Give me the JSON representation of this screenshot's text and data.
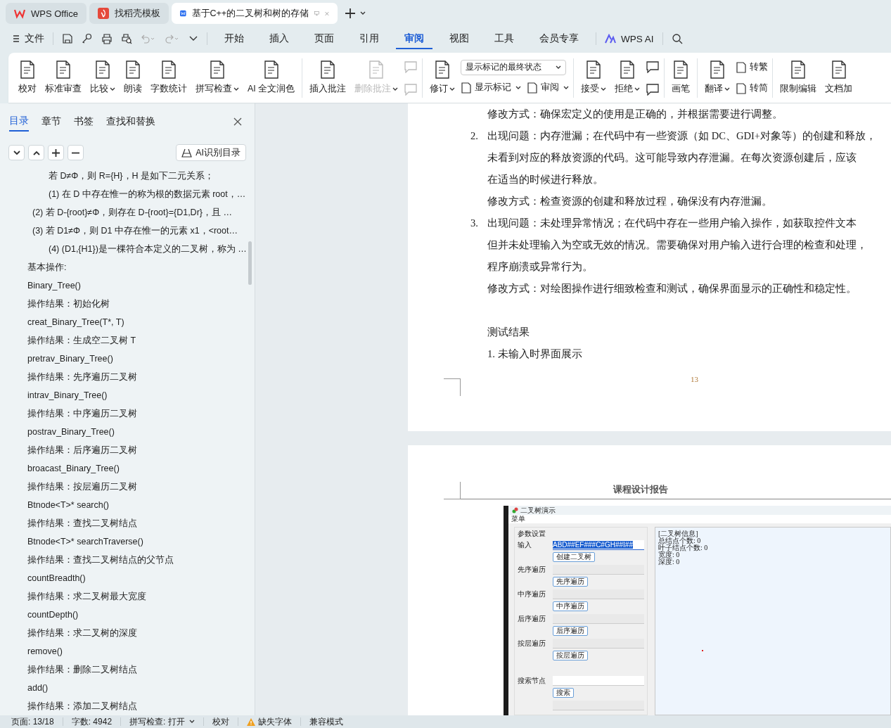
{
  "title_tabs": [
    {
      "label": "WPS Office",
      "selected": false
    },
    {
      "label": "找稻壳模板",
      "selected": false
    },
    {
      "label": "基于C++的二叉树和树的存储",
      "selected": true
    }
  ],
  "menu": {
    "file": "文件",
    "tabs": [
      {
        "label": "开始",
        "selected": false
      },
      {
        "label": "插入",
        "selected": false
      },
      {
        "label": "页面",
        "selected": false
      },
      {
        "label": "引用",
        "selected": false
      },
      {
        "label": "审阅",
        "selected": true
      },
      {
        "label": "视图",
        "selected": false
      },
      {
        "label": "工具",
        "selected": false
      },
      {
        "label": "会员专享",
        "selected": false
      }
    ],
    "ai": "WPS AI"
  },
  "ribbon": {
    "groups": [
      {
        "columns": [
          [
            [
              {
                "kind": "large",
                "label": "校对",
                "dropdown": false,
                "disabled": false
              }
            ]
          ],
          [
            [
              {
                "kind": "large",
                "label": "标准审查",
                "dropdown": false,
                "disabled": false
              }
            ]
          ],
          [
            [
              {
                "kind": "large",
                "label": "比较",
                "dropdown": true,
                "disabled": false
              }
            ]
          ],
          [
            [
              {
                "kind": "large",
                "label": "朗读",
                "dropdown": false,
                "disabled": false
              }
            ]
          ],
          [
            [
              {
                "kind": "large",
                "label": "字数统计",
                "dropdown": false,
                "disabled": false
              }
            ]
          ],
          [
            [
              {
                "kind": "large",
                "label": "拼写检查",
                "dropdown": true,
                "disabled": false
              }
            ]
          ],
          [
            [
              {
                "kind": "large",
                "label": "AI 全文润色",
                "dropdown": false,
                "disabled": false
              }
            ]
          ]
        ]
      },
      {
        "columns": [
          [
            [
              {
                "kind": "large",
                "label": "插入批注",
                "dropdown": false,
                "disabled": false
              }
            ]
          ],
          [
            [
              {
                "kind": "large",
                "label": "删除批注",
                "dropdown": true,
                "disabled": true
              }
            ]
          ],
          [
            [
              {
                "kind": "icon",
                "disabled": true
              }
            ],
            [
              {
                "kind": "icon",
                "disabled": true
              }
            ]
          ]
        ]
      },
      {
        "columns": [
          [
            [
              {
                "kind": "large",
                "label": "修订",
                "dropdown": true,
                "disabled": false
              }
            ]
          ],
          [
            [
              {
                "kind": "select",
                "label": "显示标记的最终状态"
              }
            ],
            [
              {
                "kind": "small",
                "label": "显示标记",
                "dropdown": true,
                "disabled": false
              },
              {
                "kind": "small",
                "label": "审阅",
                "dropdown": true,
                "disabled": false
              }
            ]
          ]
        ]
      },
      {
        "columns": [
          [
            [
              {
                "kind": "large",
                "label": "接受",
                "dropdown": true,
                "disabled": false
              }
            ]
          ],
          [
            [
              {
                "kind": "large",
                "label": "拒绝",
                "dropdown": true,
                "disabled": false
              }
            ]
          ],
          [
            [
              {
                "kind": "icon",
                "disabled": false
              }
            ],
            [
              {
                "kind": "icon",
                "disabled": false
              }
            ]
          ]
        ]
      },
      {
        "columns": [
          [
            [
              {
                "kind": "large",
                "label": "画笔",
                "dropdown": false,
                "disabled": false
              }
            ]
          ]
        ]
      },
      {
        "columns": [
          [
            [
              {
                "kind": "large",
                "label": "翻译",
                "dropdown": true,
                "disabled": false
              }
            ]
          ],
          [
            [
              {
                "kind": "small",
                "label": "转繁",
                "dropdown": false,
                "disabled": false
              }
            ],
            [
              {
                "kind": "small",
                "label": "转简",
                "dropdown": false,
                "disabled": false
              }
            ]
          ]
        ]
      },
      {
        "columns": [
          [
            [
              {
                "kind": "large",
                "label": "限制编辑",
                "dropdown": false,
                "disabled": false
              }
            ]
          ],
          [
            [
              {
                "kind": "large",
                "label": "文档加",
                "dropdown": false,
                "disabled": false
              }
            ]
          ]
        ]
      }
    ]
  },
  "sidebar": {
    "tabs": [
      {
        "label": "目录",
        "selected": true
      },
      {
        "label": "章节",
        "selected": false
      },
      {
        "label": "书签",
        "selected": false
      },
      {
        "label": "查找和替换",
        "selected": false
      }
    ],
    "ai_button": "AI识别目录",
    "toc": [
      {
        "children": [
          {
            "children": [
              {
                "text": "若 D≠Φ，则 R={H}，H 是如下二元关系；"
              },
              {
                "text": "(1) 在 D 中存在惟一的称为根的数据元素 root，…"
              }
            ]
          },
          {
            "text": "(2) 若 D-{root}≠Φ，则存在 D-{root}={D1,Dr}，且 …"
          },
          {
            "text": "(3) 若 D1≠Φ，则 D1 中存在惟一的元素 x1，<root…"
          },
          {
            "children": [
              {
                "text": "(4) (D1,{H1})是一棵符合本定义的二叉树，称为 …"
              }
            ]
          }
        ]
      },
      {
        "text": "基本操作:"
      },
      {
        "text": "Binary_Tree()"
      },
      {
        "text": "操作结果：初始化树"
      },
      {
        "text": "creat_Binary_Tree(T*, T)"
      },
      {
        "text": "操作结果：生成空二叉树 T"
      },
      {
        "text": "pretrav_Binary_Tree()"
      },
      {
        "text": "操作结果：先序遍历二叉树"
      },
      {
        "text": "intrav_Binary_Tree()"
      },
      {
        "text": "操作结果：中序遍历二叉树"
      },
      {
        "text": "postrav_Binary_Tree()"
      },
      {
        "text": "操作结果：后序遍历二叉树"
      },
      {
        "text": "broacast_Binary_Tree()"
      },
      {
        "text": "操作结果：按层遍历二叉树"
      },
      {
        "text": "Btnode<T>* search()"
      },
      {
        "text": "操作结果：查找二叉树结点"
      },
      {
        "text": "Btnode<T>* searchTraverse()"
      },
      {
        "text": "操作结果：查找二叉树结点的父节点"
      },
      {
        "text": "countBreadth()"
      },
      {
        "text": "操作结果：求二叉树最大宽度"
      },
      {
        "text": "countDepth()"
      },
      {
        "text": "操作结果：求二叉树的深度"
      },
      {
        "text": "remove()"
      },
      {
        "text": "操作结果：删除二叉树结点"
      },
      {
        "text": "add()"
      },
      {
        "text": "操作结果：添加二叉树结点"
      }
    ]
  },
  "page1": {
    "paragraphs": [
      {
        "kind": "text",
        "lines": [
          "修改方式：确保宏定义的使用是正确的，并根据需要进行调整。"
        ]
      },
      {
        "kind": "numbered",
        "number": "2.",
        "lines": [
          "出现问题：内存泄漏；在代码中有一些资源（如 DC、GDI+对象等）的创建和释放，",
          "未看到对应的释放资源的代码。这可能导致内存泄漏。在每次资源创建后，应该",
          "在适当的时候进行释放。",
          "修改方式：检查资源的创建和释放过程，确保没有内存泄漏。"
        ]
      },
      {
        "kind": "numbered",
        "number": "3.",
        "lines": [
          "出现问题：未处理异常情况；在代码中存在一些用户输入操作，如获取控件文本",
          "但并未处理输入为空或无效的情况。需要确保对用户输入进行合理的检查和处理，",
          "程序崩溃或异常行为。",
          "修改方式：对绘图操作进行细致检查和测试，确保界面显示的正确性和稳定性。"
        ]
      },
      {
        "kind": "heading",
        "lines": [
          "测试结果"
        ]
      },
      {
        "kind": "text",
        "lines": [
          "1. 未输入时界面展示"
        ]
      }
    ],
    "page_number": "13"
  },
  "page2": {
    "header": "课程设计报告",
    "figure": {
      "window_title": "二叉树演示",
      "menu": "菜单",
      "group_title": "参数设置",
      "input": {
        "label": "输入",
        "value": "ABD##EF###C#GH##I##",
        "text_selected": true
      },
      "create_button": "创建二叉树",
      "traversals": [
        {
          "label": "先序遍历",
          "button": "先序遍历"
        },
        {
          "label": "中序遍历",
          "button": "中序遍历"
        },
        {
          "label": "后序遍历",
          "button": "后序遍历"
        },
        {
          "label": "按层遍历",
          "button": "按层遍历"
        }
      ],
      "search": {
        "label": "搜索节点",
        "button": "搜索"
      },
      "info": [
        "[二叉树信息]",
        "总结点个数: 0",
        "叶子结点个数: 0",
        "宽度: 0",
        "深度: 0"
      ]
    }
  },
  "status_bar": {
    "page": "页面: 13/18",
    "words": "字数: 4942",
    "spell": "拼写检查: 打开",
    "proof": "校对",
    "missing_fonts": "缺失字体",
    "compat": "兼容模式"
  }
}
